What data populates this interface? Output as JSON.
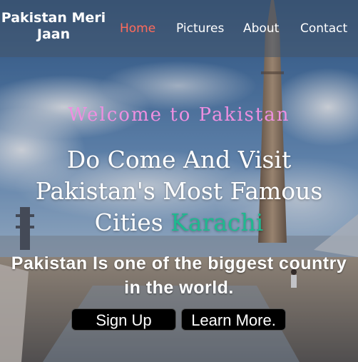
{
  "colors": {
    "sky_top": "#3d6a9e",
    "sky_mid": "#7fa7cc",
    "navbar_bg": "rgba(70, 85, 105, 0.55)",
    "nav_active": "#ff6b5b",
    "welcome_pink": "#ee8fe0",
    "city_green": "#1fb98f",
    "button_bg": "#000000",
    "text_white": "#ffffff"
  },
  "navbar": {
    "brand_line1": "Pakistan Meri",
    "brand_line2": "Jaan",
    "links": [
      {
        "label": "Home",
        "active": true
      },
      {
        "label": "Pictures",
        "active": false
      },
      {
        "label": "About",
        "active": false
      },
      {
        "label": "Contact",
        "active": false
      }
    ]
  },
  "hero": {
    "welcome": "Welcome to Pakistan",
    "headline_line1": "Do Come And Visit",
    "headline_line2": "Pakistan's Most Famous",
    "headline_line3": "Cities",
    "city": "Karachi",
    "tagline_line1": "Pakistan Is one of the biggest country",
    "tagline_line2": "in the world.",
    "buttons": {
      "signup": "Sign Up",
      "learn_more": "Learn More."
    }
  },
  "background": {
    "image": "faisal-mosque-minaret-photo"
  }
}
